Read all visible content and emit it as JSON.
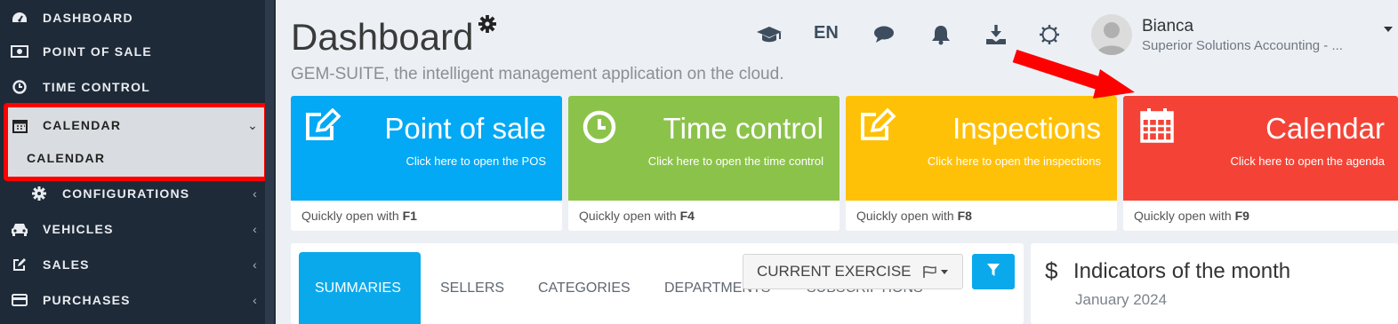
{
  "sidebar": {
    "items": [
      {
        "label": "DASHBOARD",
        "icon": "dashboard-icon"
      },
      {
        "label": "POINT OF SALE",
        "icon": "money-icon"
      },
      {
        "label": "TIME CONTROL",
        "icon": "clock-icon"
      },
      {
        "label": "CALENDAR",
        "icon": "calendar-icon",
        "chevron": "⌄"
      },
      {
        "label": "CALENDAR",
        "submenu": true
      },
      {
        "label": "CONFIGURATIONS",
        "icon": "gear-icon",
        "chevron": "‹"
      },
      {
        "label": "VEHICLES",
        "icon": "car-icon",
        "chevron": "‹"
      },
      {
        "label": "SALES",
        "icon": "edit-icon",
        "chevron": "‹"
      },
      {
        "label": "PURCHASES",
        "icon": "card-icon",
        "chevron": "‹"
      }
    ]
  },
  "header": {
    "title": "Dashboard",
    "subtitle": "GEM-SUITE, the intelligent management application on the cloud.",
    "language": "EN",
    "user": {
      "name": "Bianca",
      "company": "Superior Solutions Accounting - ..."
    }
  },
  "tiles": [
    {
      "title": "Point of sale",
      "desc": "Click here to open the POS",
      "shortcut_prefix": "Quickly open with ",
      "shortcut": "F1",
      "color": "#03a9f4",
      "icon": "edit-icon"
    },
    {
      "title": "Time control",
      "desc": "Click here to open the time control",
      "shortcut_prefix": "Quickly open with ",
      "shortcut": "F4",
      "color": "#8bc34a",
      "icon": "clock-icon"
    },
    {
      "title": "Inspections",
      "desc": "Click here to open the inspections",
      "shortcut_prefix": "Quickly open with ",
      "shortcut": "F8",
      "color": "#ffc107",
      "icon": "edit-icon"
    },
    {
      "title": "Calendar",
      "desc": "Click here to open the agenda",
      "shortcut_prefix": "Quickly open with ",
      "shortcut": "F9",
      "color": "#f44336",
      "icon": "calendar-icon"
    }
  ],
  "tabs": [
    "SUMMARIES",
    "SELLERS",
    "CATEGORIES",
    "DEPARTMENTS",
    "SUBSCRIPTIONS"
  ],
  "exercise_label": "CURRENT EXERCISE",
  "indicators": {
    "title": "Indicators of the month",
    "month": "January 2024",
    "currency_symbol": "$"
  },
  "colors": {
    "sidebar_bg": "#1f2a38",
    "accent": "#0aa9ec",
    "highlight": "#ff0000"
  }
}
